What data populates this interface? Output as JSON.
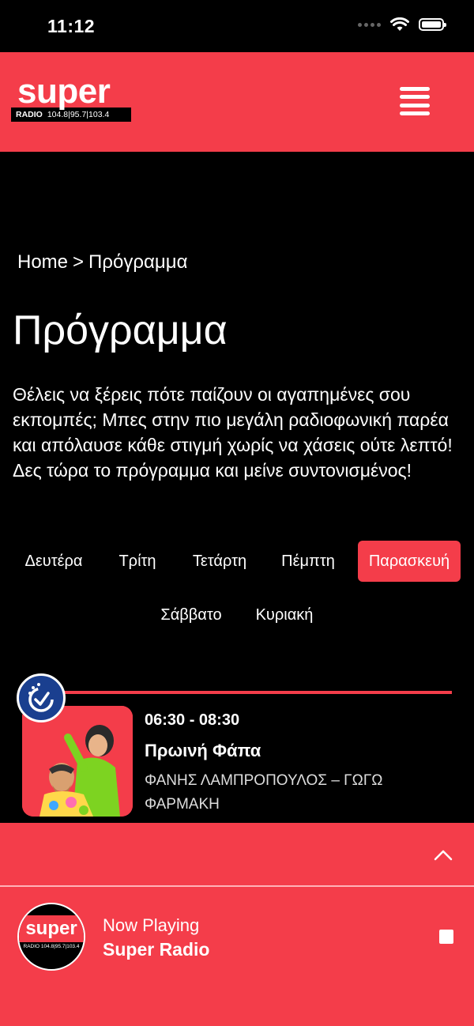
{
  "status": {
    "time": "11:12"
  },
  "header": {
    "logo_word": "super",
    "logo_radio": "RADIO",
    "logo_freqs": "104.8|95.7|103.4",
    "menu_icon": "hamburger-menu-icon"
  },
  "breadcrumb": {
    "home": "Home",
    "separator": ">",
    "current": "Πρόγραμμα"
  },
  "page": {
    "title": "Πρόγραμμα",
    "intro": "Θέλεις να ξέρεις πότε παίζουν οι αγαπημένες σου εκπομπές; Μπες στην πιο μεγάλη ραδιοφωνική παρέα και απόλαυσε κάθε στιγμή χωρίς να χάσεις ούτε λεπτό! Δες τώρα το πρόγραμμα και μείνε συντονισμένος!"
  },
  "days": [
    {
      "label": "Δευτέρα",
      "active": false
    },
    {
      "label": "Τρίτη",
      "active": false
    },
    {
      "label": "Τετάρτη",
      "active": false
    },
    {
      "label": "Πέμπτη",
      "active": false
    },
    {
      "label": "Παρασκευή",
      "active": true
    },
    {
      "label": "Σάββατο",
      "active": false
    },
    {
      "label": "Κυριακή",
      "active": false
    }
  ],
  "show": {
    "time": "06:30 - 08:30",
    "title": "Πρωινή Φάπα",
    "hosts": "ΦΑΝΗΣ ΛΑΜΠΡΟΠΟΥΛΟΣ – ΓΩΓΩ ΦΑΡΜΑΚΗ",
    "badge_icon": "clock-check-icon"
  },
  "player": {
    "expand_icon": "chevron-up-icon",
    "now_playing_label": "Now Playing",
    "station": "Super Radio",
    "logo_word": "super",
    "logo_bar": "RADIO 104.8|95.7|103.4",
    "stop_icon": "stop-icon"
  },
  "colors": {
    "accent": "#f43d4a",
    "background": "#000000",
    "badge": "#1a3f8f"
  }
}
